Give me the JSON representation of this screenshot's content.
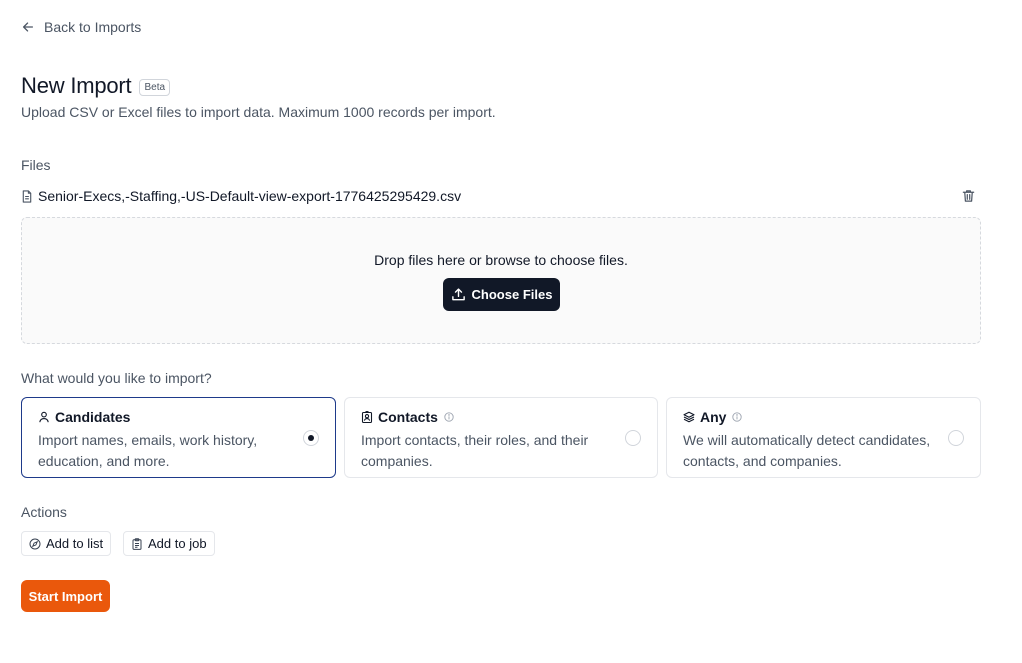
{
  "nav": {
    "back_label": "Back to Imports"
  },
  "header": {
    "title": "New Import",
    "badge": "Beta",
    "subtitle": "Upload CSV or Excel files to import data. Maximum 1000 records per import."
  },
  "files": {
    "section_label": "Files",
    "items": [
      {
        "name": "Senior-Execs,-Staffing,-US-Default-view-export-1776425295429.csv"
      }
    ],
    "dropzone_text": "Drop files here or browse to choose files.",
    "choose_button_label": "Choose Files"
  },
  "import_type": {
    "question": "What would you like to import?",
    "selected": "candidates",
    "options": [
      {
        "key": "candidates",
        "title": "Candidates",
        "description": "Import names, emails, work history, education, and more.",
        "icon": "user-icon",
        "info": false
      },
      {
        "key": "contacts",
        "title": "Contacts",
        "description": "Import contacts, their roles, and their companies.",
        "icon": "contact-badge-icon",
        "info": true
      },
      {
        "key": "any",
        "title": "Any",
        "description": "We will automatically detect candidates, contacts, and companies.",
        "icon": "layers-icon",
        "info": true
      }
    ]
  },
  "actions": {
    "section_label": "Actions",
    "add_to_list_label": "Add to list",
    "add_to_job_label": "Add to job"
  },
  "footer": {
    "start_label": "Start Import"
  },
  "colors": {
    "primary_dark": "#111827",
    "accent_orange": "#ea580c",
    "selected_border": "#1e3a8a"
  }
}
